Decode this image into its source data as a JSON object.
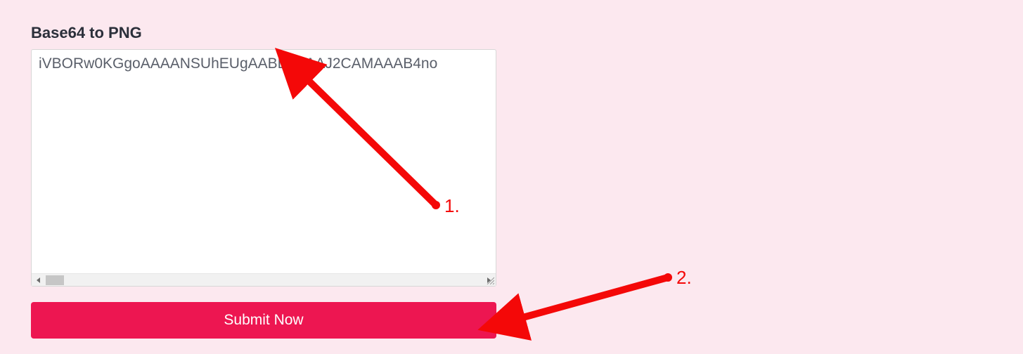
{
  "page": {
    "title": "Base64 to PNG"
  },
  "textarea": {
    "value": "iVBORw0KGgoAAAANSUhEUgAABLAAAAJ2CAMAAAB4no"
  },
  "submit": {
    "label": "Submit Now"
  },
  "annotations": {
    "arrow1_label": "1.",
    "arrow2_label": "2."
  },
  "colors": {
    "accent": "#ed1651",
    "annotation": "#f40808"
  }
}
